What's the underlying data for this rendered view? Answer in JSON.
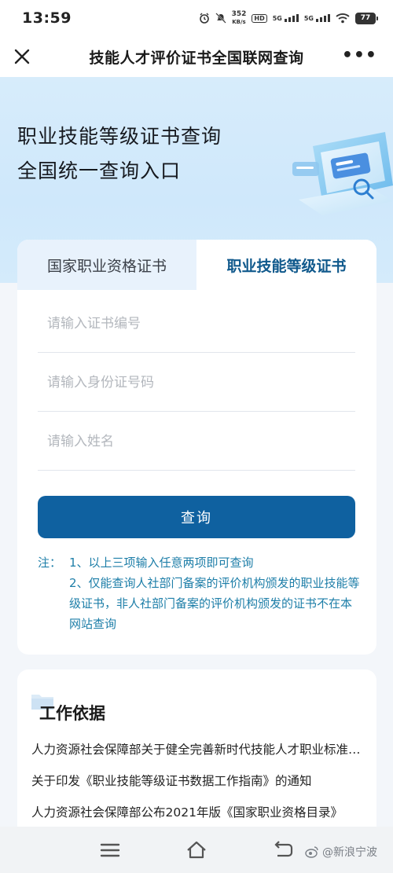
{
  "status_bar": {
    "time": "13:59",
    "net_speed_value": "352",
    "net_speed_unit": "KB/s",
    "hd_label": "HD",
    "signal_1_label": "5G",
    "signal_2_label": "5G",
    "battery": "77"
  },
  "nav": {
    "title": "技能人才评价证书全国联网查询",
    "more_label": "•••"
  },
  "hero": {
    "line1": "职业技能等级证书查询",
    "line2": "全国统一查询入口"
  },
  "tabs": [
    {
      "label": "国家职业资格证书",
      "active": false
    },
    {
      "label": "职业技能等级证书",
      "active": true
    }
  ],
  "form": {
    "cert_no_placeholder": "请输入证书编号",
    "id_no_placeholder": "请输入身份证号码",
    "name_placeholder": "请输入姓名",
    "submit_label": "查询"
  },
  "note": {
    "label": "注：",
    "items": [
      "1、以上三项输入任意两项即可查询",
      "2、仅能查询人社部门备案的评价机构颁发的职业技能等级证书，非人社部门备案的评价机构颁发的证书不在本网站查询"
    ]
  },
  "basis": {
    "title": "工作依据",
    "items": [
      "人力资源社会保障部关于健全完善新时代技能人才职业标准体系的通知",
      "关于印发《职业技能等级证书数据工作指南》的通知",
      "人力资源社会保障部公布2021年版《国家职业资格目录》"
    ]
  },
  "watermark": "@新浪宁波",
  "colors": {
    "primary": "#0f61a0",
    "tab_active_text": "#10598c",
    "note_text": "#1d7ea8",
    "hero_bg": "#d7ecfb"
  }
}
